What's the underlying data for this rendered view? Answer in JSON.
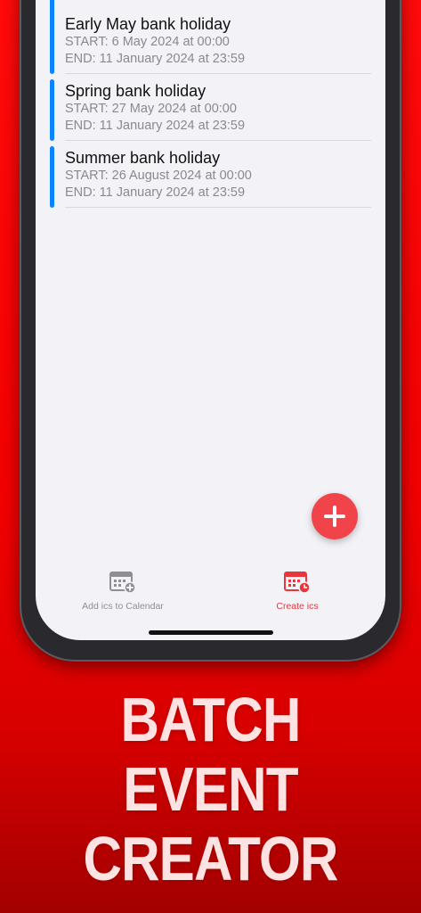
{
  "events": [
    {
      "title": "Early May bank holiday",
      "start": "START: 6 May 2024 at 00:00",
      "end": "END: 11 January 2024 at 23:59"
    },
    {
      "title": "Spring bank holiday",
      "start": "START: 27 May 2024 at 00:00",
      "end": "END: 11 January 2024 at 23:59"
    },
    {
      "title": "Summer bank holiday",
      "start": "START: 26 August 2024 at 00:00",
      "end": "END: 11 January 2024 at 23:59"
    }
  ],
  "tabs": {
    "add_label": "Add ics to Calendar",
    "create_label": "Create ics"
  },
  "headline": {
    "line1": "BATCH",
    "line2": "EVENT",
    "line3": "CREATOR"
  },
  "colors": {
    "accent_blue": "#0a84ff",
    "accent_red": "#e8363d",
    "background_red": "#f20000"
  }
}
